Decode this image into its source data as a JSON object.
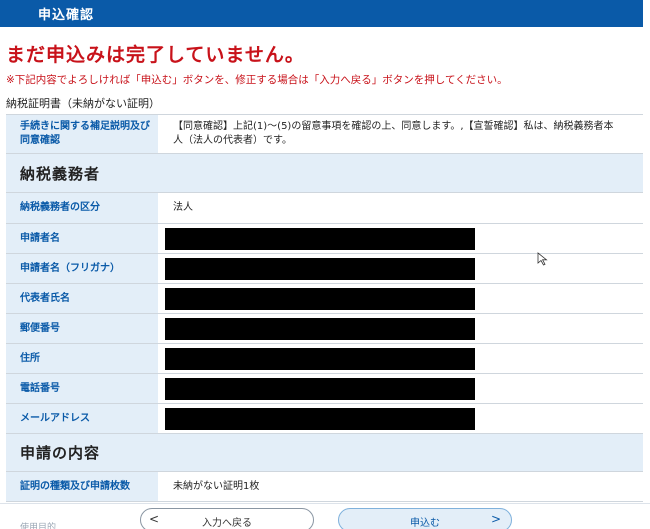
{
  "header": {
    "title": "申込確認"
  },
  "alert": {
    "title": "まだ申込みは完了していません。",
    "note": "※下記内容でよろしければ「申込む」ボタンを、修正する場合は「入力へ戻る」ボタンを押してください。"
  },
  "form_name": "納税証明書（未納がない証明）",
  "supplement": {
    "label": "手続きに関する補足説明及び同意確認",
    "value": "【同意確認】上記(1)〜(5)の留意事項を確認の上、同意します。,【宣誓確認】私は、納税義務者本人（法人の代表者）です。"
  },
  "taxpayer_section": {
    "title": "納税義務者",
    "rows": [
      {
        "label": "納税義務者の区分",
        "value": "法人"
      },
      {
        "label": "申請者名"
      },
      {
        "label": "申請者名（フリガナ）"
      },
      {
        "label": "代表者氏名"
      },
      {
        "label": "郵便番号"
      },
      {
        "label": "住所"
      },
      {
        "label": "電話番号"
      },
      {
        "label": "メールアドレス"
      }
    ]
  },
  "application_section": {
    "title": "申請の内容",
    "rows": [
      {
        "label": "証明の種類及び申請枚数",
        "value": "未納がない証明1枚"
      }
    ],
    "peek_label": "使用目的"
  },
  "buttons": {
    "back": {
      "label": "入力へ戻る",
      "arrow": "<"
    },
    "submit": {
      "label": "申込む",
      "arrow": ">"
    }
  }
}
